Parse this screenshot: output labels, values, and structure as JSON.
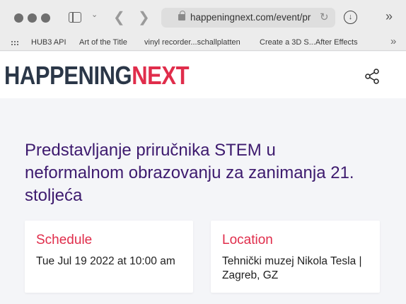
{
  "browser": {
    "url": "happeningnext.com/event/pr",
    "bookmarks": [
      "HUB3 API",
      "Art of the Title",
      "vinyl recorder...schallplatten",
      "Create a 3D S...After Effects"
    ]
  },
  "site": {
    "logo_part1": "HAPPENING",
    "logo_part2": "NEXT"
  },
  "event": {
    "title": "Predstavljanje priručnika STEM u neformalnom obrazovanju za zanimanja 21. stoljeća",
    "schedule": {
      "heading": "Schedule",
      "value": "Tue Jul 19 2022 at 10:00 am"
    },
    "location": {
      "heading": "Location",
      "value": "Tehnički muzej Nikola Tesla | Zagreb, GZ"
    }
  },
  "colors": {
    "brand_dark": "#2b3748",
    "brand_red": "#e02d4b",
    "title_purple": "#3d1a6e"
  },
  "icons": [
    "sidebar-icon",
    "chevron-down-icon",
    "back-arrow-icon",
    "forward-arrow-icon",
    "lock-icon",
    "reload-icon",
    "download-icon",
    "chevron-double-right-icon",
    "grid-icon",
    "share-icon"
  ]
}
